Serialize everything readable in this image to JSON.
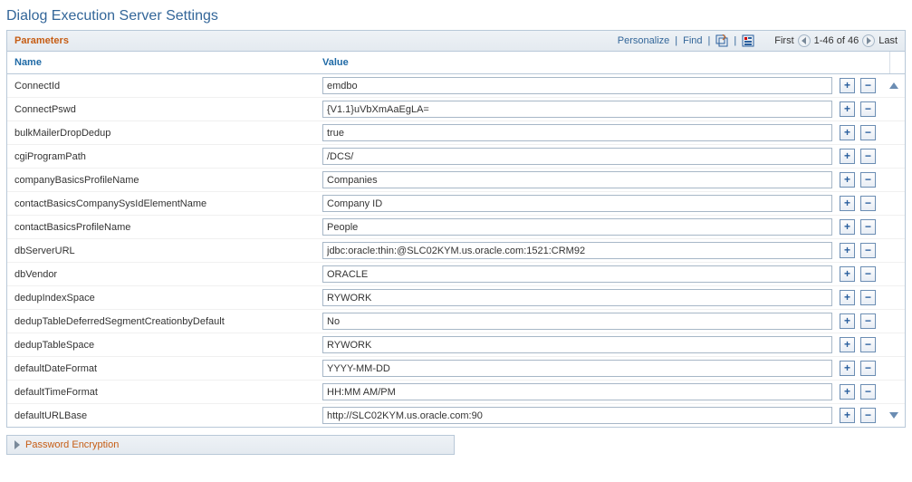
{
  "title": "Dialog Execution Server Settings",
  "grid": {
    "title": "Parameters",
    "tools": {
      "personalize": "Personalize",
      "find": "Find",
      "first": "First",
      "last": "Last",
      "counter": "1-46 of 46"
    },
    "columns": {
      "name": "Name",
      "value": "Value"
    }
  },
  "rows": [
    {
      "name": "ConnectId",
      "value": "emdbo"
    },
    {
      "name": "ConnectPswd",
      "value": "{V1.1}uVbXmAaEgLA="
    },
    {
      "name": "bulkMailerDropDedup",
      "value": "true"
    },
    {
      "name": "cgiProgramPath",
      "value": "/DCS/"
    },
    {
      "name": "companyBasicsProfileName",
      "value": "Companies"
    },
    {
      "name": "contactBasicsCompanySysIdElementName",
      "value": "Company ID"
    },
    {
      "name": "contactBasicsProfileName",
      "value": "People"
    },
    {
      "name": "dbServerURL",
      "value": "jdbc:oracle:thin:@SLC02KYM.us.oracle.com:1521:CRM92"
    },
    {
      "name": "dbVendor",
      "value": "ORACLE"
    },
    {
      "name": "dedupIndexSpace",
      "value": "RYWORK"
    },
    {
      "name": "dedupTableDeferredSegmentCreationbyDefault",
      "value": "No"
    },
    {
      "name": "dedupTableSpace",
      "value": "RYWORK"
    },
    {
      "name": "defaultDateFormat",
      "value": "YYYY-MM-DD"
    },
    {
      "name": "defaultTimeFormat",
      "value": "HH:MM AM/PM"
    },
    {
      "name": "defaultURLBase",
      "value": "http://SLC02KYM.us.oracle.com:90"
    }
  ],
  "section": {
    "label": "Password Encryption"
  }
}
